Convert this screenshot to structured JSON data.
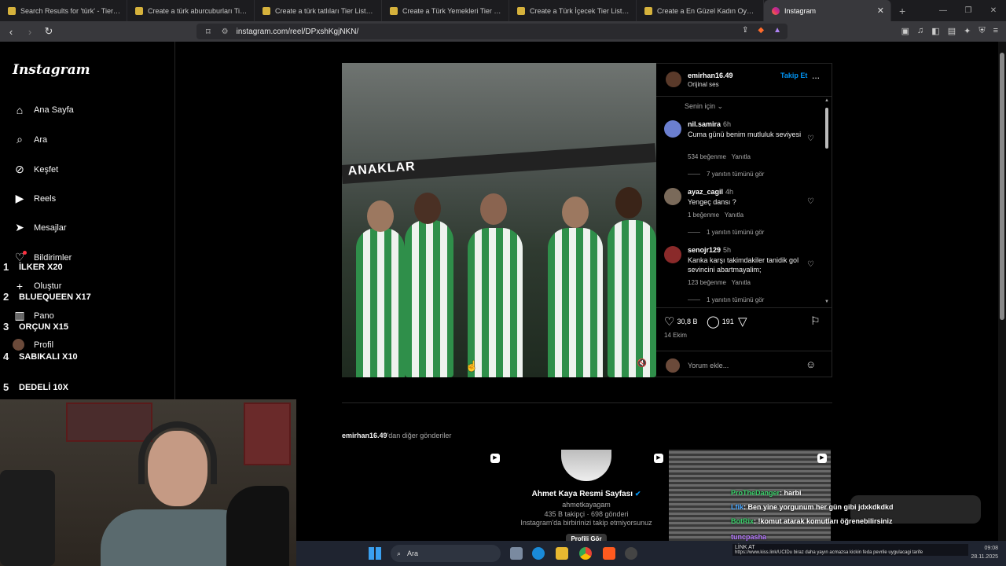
{
  "browser": {
    "tabs": [
      {
        "label": "Search Results for 'türk' - TierMaker"
      },
      {
        "label": "Create a türk aburcuburları Tier List - TierMaker"
      },
      {
        "label": "Create a türk tatlıları Tier List - TierMaker"
      },
      {
        "label": "Create a Türk Yemekleri Tier List - TierMaker"
      },
      {
        "label": "Create a Türk İçecek Tier List - TierMaker"
      },
      {
        "label": "Create a En Güzel Kadın Oyuncular Tier List"
      },
      {
        "label": "Instagram"
      }
    ],
    "url": "instagram.com/reel/DPxshKgjNKN/"
  },
  "sidebar": {
    "logo": "Instagram",
    "items": [
      {
        "label": "Ana Sayfa",
        "icon": "home-icon"
      },
      {
        "label": "Ara",
        "icon": "search-icon"
      },
      {
        "label": "Keşfet",
        "icon": "compass-icon"
      },
      {
        "label": "Reels",
        "icon": "reels-icon"
      },
      {
        "label": "Mesajlar",
        "icon": "send-icon"
      },
      {
        "label": "Bildirimler",
        "icon": "heart-icon"
      },
      {
        "label": "Oluştur",
        "icon": "plus-icon"
      },
      {
        "label": "Pano",
        "icon": "dashboard-icon"
      },
      {
        "label": "Profil",
        "icon": "avatar"
      }
    ]
  },
  "overlay_ranking": [
    {
      "num": "1",
      "label": "İLKER X20"
    },
    {
      "num": "2",
      "label": "BLUEQUEEN X17"
    },
    {
      "num": "3",
      "label": "ORÇUN X15"
    },
    {
      "num": "4",
      "label": "SABIKALI X10"
    },
    {
      "num": "5",
      "label": "DEDELİ 10X"
    }
  ],
  "post": {
    "username": "emirhan16.49",
    "audio": "Orijinal ses",
    "follow": "Takip Et",
    "more": "...",
    "video_banner": "ANAKLAR",
    "sort": "Senin için",
    "comments": [
      {
        "user": "nil.samira",
        "time": "6h",
        "text": "Cuma günü benim mutluluk seviyesi",
        "likes": "534 beğenme",
        "reply": "Yanıtla",
        "replies": "7 yanıtın tümünü gör"
      },
      {
        "user": "ayaz_cagil",
        "time": "4h",
        "text": "Yengeç dansı ?",
        "likes": "1 beğenme",
        "reply": "Yanıtla",
        "replies": "1 yanıtın tümünü gör"
      },
      {
        "user": "senojr129",
        "time": "5h",
        "text": "Kanka karşı takimdakiler tanidik gol sevincini abartmayalim;",
        "likes": "123 beğenme",
        "reply": "Yanıtla",
        "replies": "1 yanıtın tümünü gör"
      }
    ],
    "like_count": "30,8 B",
    "comment_count": "191",
    "date": "14 Ekim",
    "add_comment_placeholder": "Yorum ekle..."
  },
  "more_posts": {
    "user": "emirhan16.49",
    "suffix": "'dan diğer gönderiler"
  },
  "suggest": {
    "name": "Ahmet Kaya Resmi Sayfası",
    "handle": "ahmetkayagam",
    "stats": "435 B takipçi · 698 gönderi",
    "note": "Instagram'da birbirinizi takip etmiyorsunuz",
    "button": "Profili Gör"
  },
  "stream_chat": [
    {
      "name": "ProTheDanger",
      "text": ": harbi"
    },
    {
      "name": "Lfik",
      "text": ": Ben yine yorgunum her gün gibi jdxkdkdkd"
    },
    {
      "name": "BotRix",
      "text": ": !komut atarak komutları öğrenebilirsiniz"
    },
    {
      "name": "tuncpasha",
      "text": ""
    }
  ],
  "ticker": {
    "label": "LİNK AT",
    "text": "https://www.kiss.link/UCIDu biraz daha yayın acmazsa kickin feda pevrile uygulacagi tarife"
  },
  "taskbar": {
    "search_label": "Ara",
    "time": "09:08",
    "date": "28.11.2025"
  }
}
